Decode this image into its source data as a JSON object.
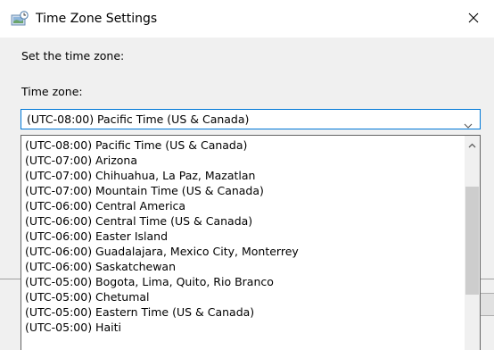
{
  "window": {
    "title": "Time Zone Settings"
  },
  "instruction": "Set the time zone:",
  "timezone_label": "Time zone:",
  "timezone_select": {
    "selected": "(UTC-08:00) Pacific Time (US & Canada)"
  },
  "options": [
    "(UTC-08:00) Pacific Time (US & Canada)",
    "(UTC-07:00) Arizona",
    "(UTC-07:00) Chihuahua, La Paz, Mazatlan",
    "(UTC-07:00) Mountain Time (US & Canada)",
    "(UTC-06:00) Central America",
    "(UTC-06:00) Central Time (US & Canada)",
    "(UTC-06:00) Easter Island",
    "(UTC-06:00) Guadalajara, Mexico City, Monterrey",
    "(UTC-06:00) Saskatchewan",
    "(UTC-05:00) Bogota, Lima, Quito, Rio Branco",
    "(UTC-05:00) Chetumal",
    "(UTC-05:00) Eastern Time (US & Canada)",
    "(UTC-05:00) Haiti"
  ],
  "colors": {
    "focus_border": "#0078d7",
    "dialog_background": "#f0f0f0",
    "scroll_thumb": "#cdcdcd"
  },
  "icons": {
    "title": "globe-clock-icon",
    "close": "close-icon",
    "dropdown_arrow": "chevron-down-icon",
    "scroll_up": "chevron-up-icon"
  }
}
